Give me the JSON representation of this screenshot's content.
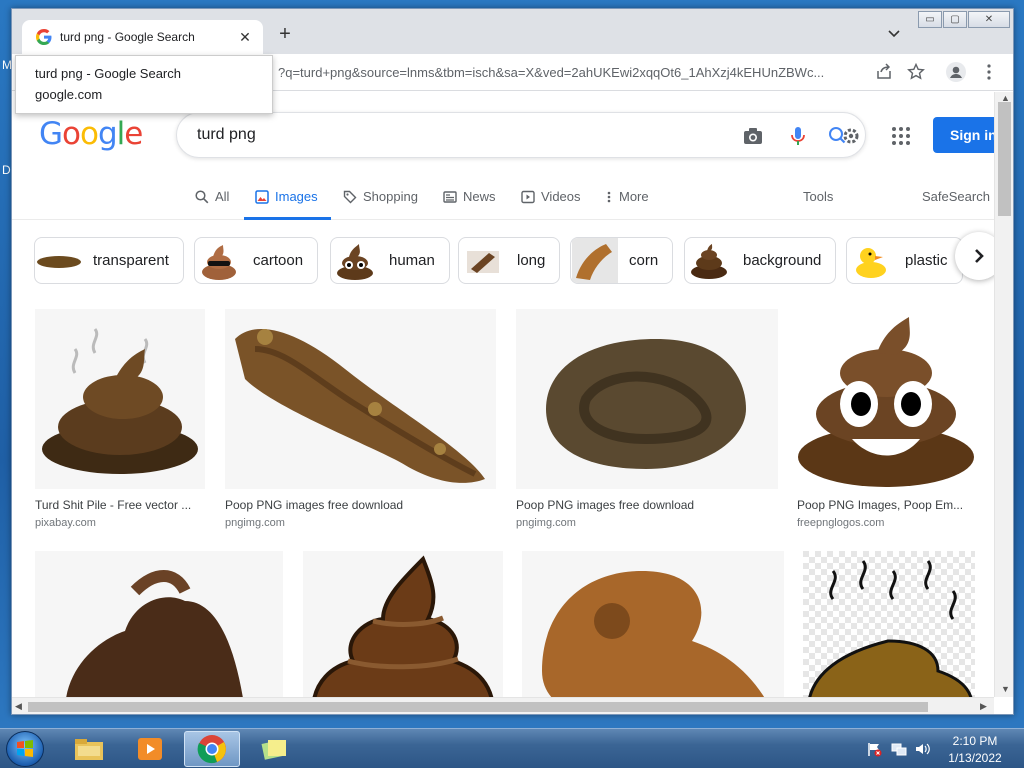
{
  "desktop": {
    "left_letters": [
      "M",
      "D"
    ]
  },
  "browser": {
    "tab": {
      "title": "turd png - Google Search",
      "close_glyph": "✕"
    },
    "new_tab_glyph": "+",
    "window_controls": {
      "minimize": "▭",
      "maximize": "▢",
      "close": "✕"
    },
    "url": "?q=turd+png&source=lnms&tbm=isch&sa=X&ved=2ahUKEwi2xqqOt6_1AhXzj4kEHUnZBWc...",
    "tooltip": {
      "title": "turd png - Google Search",
      "domain": "google.com"
    }
  },
  "google": {
    "logo_letters": [
      {
        "ch": "G",
        "color": "#4285F4"
      },
      {
        "ch": "o",
        "color": "#EA4335"
      },
      {
        "ch": "o",
        "color": "#FBBC05"
      },
      {
        "ch": "g",
        "color": "#4285F4"
      },
      {
        "ch": "l",
        "color": "#34A853"
      },
      {
        "ch": "e",
        "color": "#EA4335"
      }
    ],
    "query": "turd png",
    "sign_in": "Sign in",
    "nav": {
      "all": "All",
      "images": "Images",
      "shopping": "Shopping",
      "news": "News",
      "videos": "Videos",
      "more": "More",
      "tools": "Tools",
      "safesearch": "SafeSearch"
    },
    "chips": [
      "transparent",
      "cartoon",
      "human",
      "long",
      "corn",
      "background",
      "plastic"
    ],
    "results": [
      {
        "title": "Turd Shit Pile - Free vector ...",
        "site": "pixabay.com"
      },
      {
        "title": "Poop PNG images free download",
        "site": "pngimg.com"
      },
      {
        "title": "Poop PNG images free download",
        "site": "pngimg.com"
      },
      {
        "title": "Poop PNG Images, Poop Em...",
        "site": "freepnglogos.com"
      },
      {
        "title": "",
        "site": ""
      },
      {
        "title": "",
        "site": ""
      },
      {
        "title": "",
        "site": ""
      },
      {
        "title": "",
        "site": ""
      }
    ]
  },
  "taskbar": {
    "time": "2:10 PM",
    "date": "1/13/2022"
  },
  "colors": {
    "accent": "#1a73e8",
    "poop_brown": "#6b4423"
  }
}
